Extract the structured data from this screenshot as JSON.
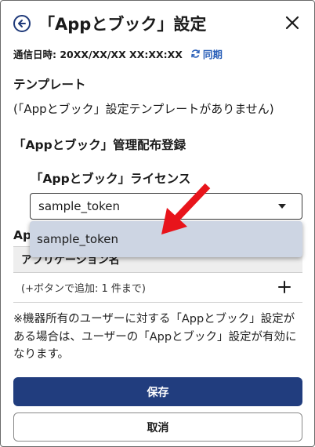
{
  "header": {
    "title": "「Appとブック」設定"
  },
  "sync": {
    "label": "通信日時: 20XX/XX/XX XX:XX:XX",
    "link_label": "同期"
  },
  "template": {
    "heading": "テンプレート",
    "note": "(「Appとブック」設定テンプレートがありません)"
  },
  "distribution": {
    "heading": "「Appとブック」管理配布登録",
    "license_heading": "「Appとブック」ライセンス",
    "license_value": "sample_token",
    "dropdown_options": [
      "sample_token"
    ]
  },
  "apps": {
    "heading": "Ap",
    "column_header": "アプリケーション名",
    "add_hint": "(+ボタンで追加: 1 件まで)"
  },
  "notice": "※機器所有のユーザーに対する「Appとブック」設定がある場合は、ユーザーの「Appとブック」設定が有効になります。",
  "buttons": {
    "save": "保存",
    "cancel": "取消"
  },
  "colors": {
    "primary": "#213d7e",
    "link": "#2a5fb8",
    "dropdown_bg": "#cdd5e3",
    "annotation_arrow": "#e8141b"
  },
  "icons": {
    "back": "back-circle-arrow-icon",
    "close": "close-icon",
    "sync": "sync-icon",
    "add": "plus-icon",
    "caret": "caret-down-icon"
  }
}
